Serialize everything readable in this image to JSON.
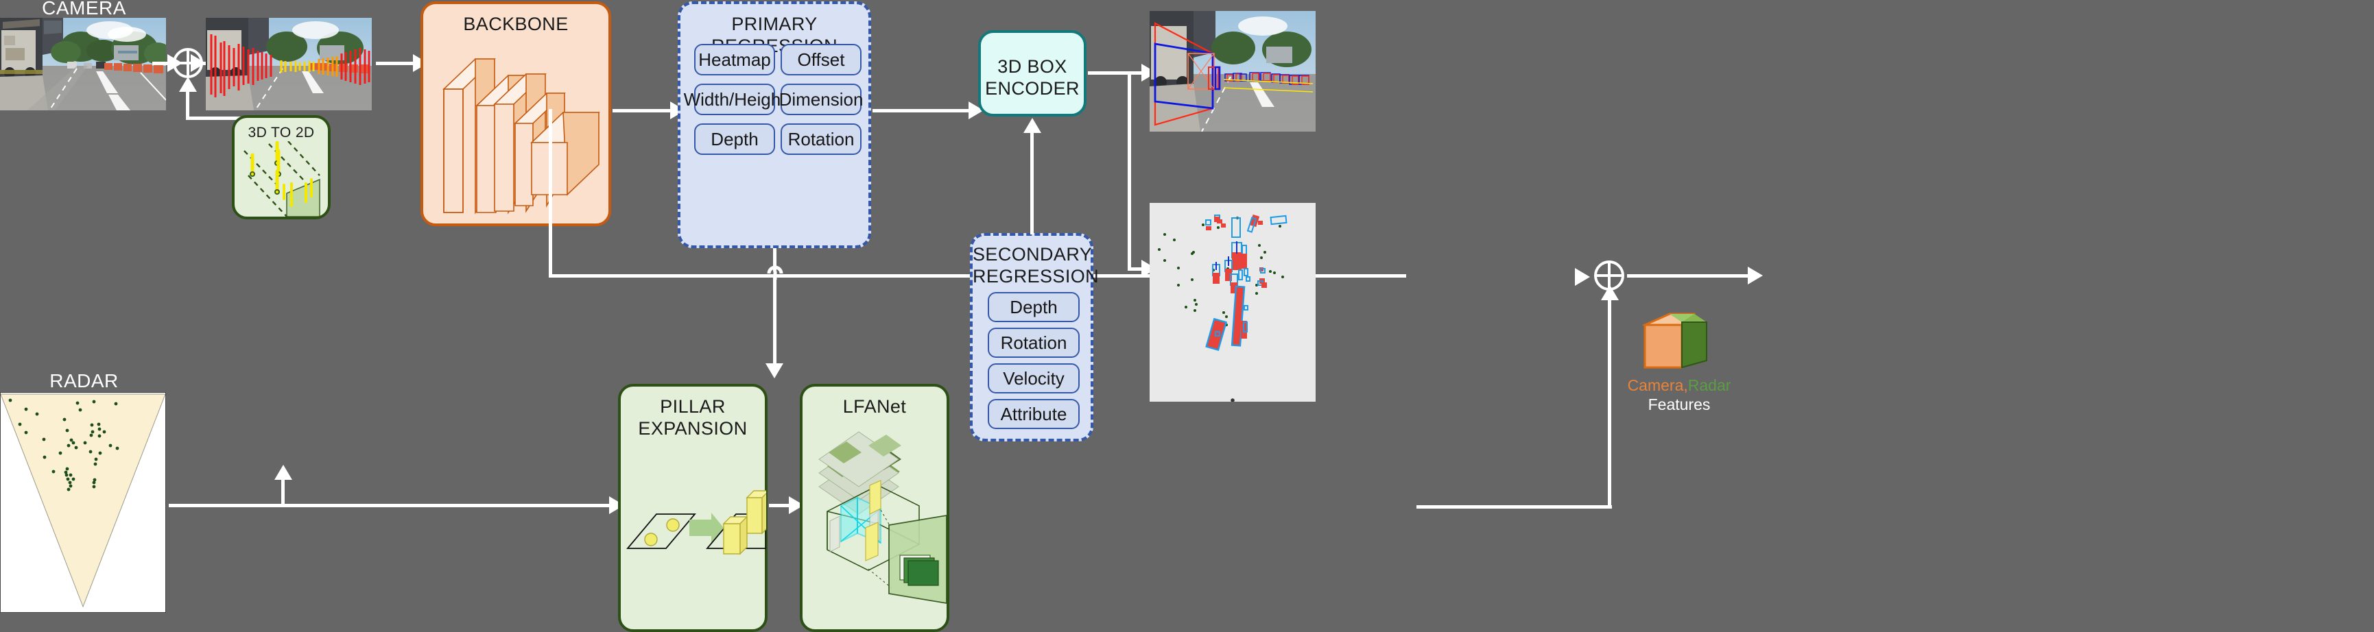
{
  "diagram": {
    "background_color": "#666666",
    "title_text_color": "#ffffff"
  },
  "inputs": {
    "camera_label": "CAMERA",
    "radar_label": "RADAR"
  },
  "blocks": {
    "backbone": {
      "label": "BACKBONE",
      "fill": "#fae0cd",
      "stroke": "#c55a11"
    },
    "primary_regression": {
      "label": "PRIMARY REGRESSION",
      "fill": "#d9e1f5",
      "stroke": "#3558a8",
      "heads": [
        "Heatmap",
        "Offset",
        "Width/Height",
        "Dimension",
        "Depth",
        "Rotation"
      ]
    },
    "box_encoder": {
      "label_line1": "3D BOX",
      "label_line2": "ENCODER",
      "fill": "#dffaf7",
      "stroke": "#12787a"
    },
    "secondary_regression": {
      "label_line1": "SECONDARY",
      "label_line2": "REGRESSION",
      "fill": "#d9e1f5",
      "stroke": "#3558a8",
      "heads": [
        "Depth",
        "Rotation",
        "Velocity",
        "Attribute"
      ]
    },
    "three_d_to_two_d": {
      "label": "3D TO 2D",
      "fill": "#e4efda",
      "stroke": "#2d5016"
    },
    "pillar_expansion": {
      "label": "PILLAR EXPANSION",
      "fill": "#e4efda",
      "stroke": "#2d5016"
    },
    "lfanet": {
      "label": "LFANet",
      "fill": "#e4efda",
      "stroke": "#2d5016"
    }
  },
  "features_icon": {
    "camera_word": "Camera,",
    "radar_word": "Radar",
    "features_word": "Features",
    "camera_color": "#e8833a",
    "radar_color": "#5a9e43"
  },
  "fusion_nodes": {
    "symbol": "circle-plus",
    "count": 2
  }
}
